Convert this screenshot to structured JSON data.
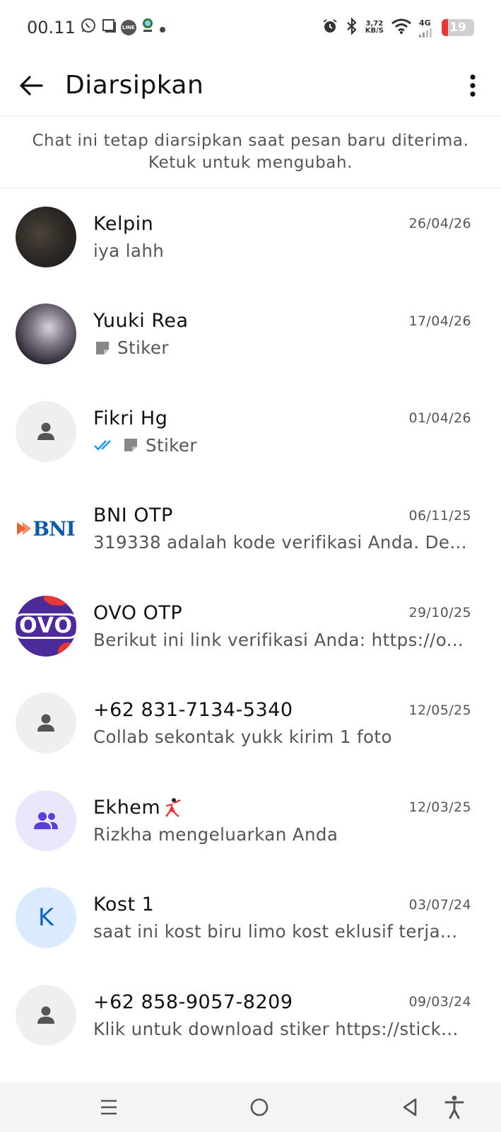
{
  "status_bar": {
    "time": "00.11",
    "net_speed_value": "3,72",
    "net_speed_unit": "KB/S",
    "network_type": "4G",
    "battery_level": "19",
    "line_badge": "LINE"
  },
  "header": {
    "title": "Diarsipkan"
  },
  "info_banner": {
    "line1": "Chat ini tetap diarsipkan saat pesan baru diterima.",
    "line2": "Ketuk untuk mengubah."
  },
  "chats": [
    {
      "name": "Kelpin",
      "date": "26/04/26",
      "preview": "iya lahh",
      "avatar": "photo"
    },
    {
      "name": "Yuuki Rea",
      "date": "17/04/26",
      "preview": "Stiker",
      "avatar": "photo",
      "preview_icon": "sticker-icon"
    },
    {
      "name": "Fikri Hg",
      "date": "01/04/26",
      "preview": "Stiker",
      "avatar": "default-person-icon",
      "preview_icon": "sticker-icon",
      "read_receipt": "double-check-icon"
    },
    {
      "name": "BNI OTP",
      "date": "06/11/25",
      "preview": "319338 adalah kode verifikasi Anda. De...",
      "avatar": "bni-logo",
      "logo_text": "BNI"
    },
    {
      "name": "OVO OTP",
      "date": "29/10/25",
      "preview": "Berikut ini link verifikasi Anda: https://o...",
      "avatar": "ovo-logo",
      "logo_text": "OVO"
    },
    {
      "name": "+62 831-7134-5340",
      "date": "12/05/25",
      "preview": "Collab sekontak yukk kirim 1 foto",
      "avatar": "default-person-icon"
    },
    {
      "name": "Ekhem",
      "date": "12/03/25",
      "preview": "Rizkha mengeluarkan Anda",
      "avatar": "group-icon",
      "name_emoji": "dancer-emoji"
    },
    {
      "name": "Kost 1",
      "date": "03/07/24",
      "preview": "saat ini kost biru limo kost eklusif terja...",
      "avatar": "letter",
      "avatar_letter": "K"
    },
    {
      "name": "+62 858-9057-8209",
      "date": "09/03/24",
      "preview": "Klik untuk download stiker https://stick...",
      "avatar": "default-person-icon"
    }
  ],
  "colors": {
    "read_receipt": "#2196f3",
    "letter_avatar_bg": "#dbeafe",
    "letter_avatar_fg": "#1565c0",
    "group_avatar_bg": "#ece6fb",
    "group_avatar_fg": "#5b3fd6",
    "ovo_purple": "#4c2a9a",
    "bni_blue": "#0a5aa8",
    "bni_orange": "#e8622a",
    "battery_low": "#e53935"
  }
}
